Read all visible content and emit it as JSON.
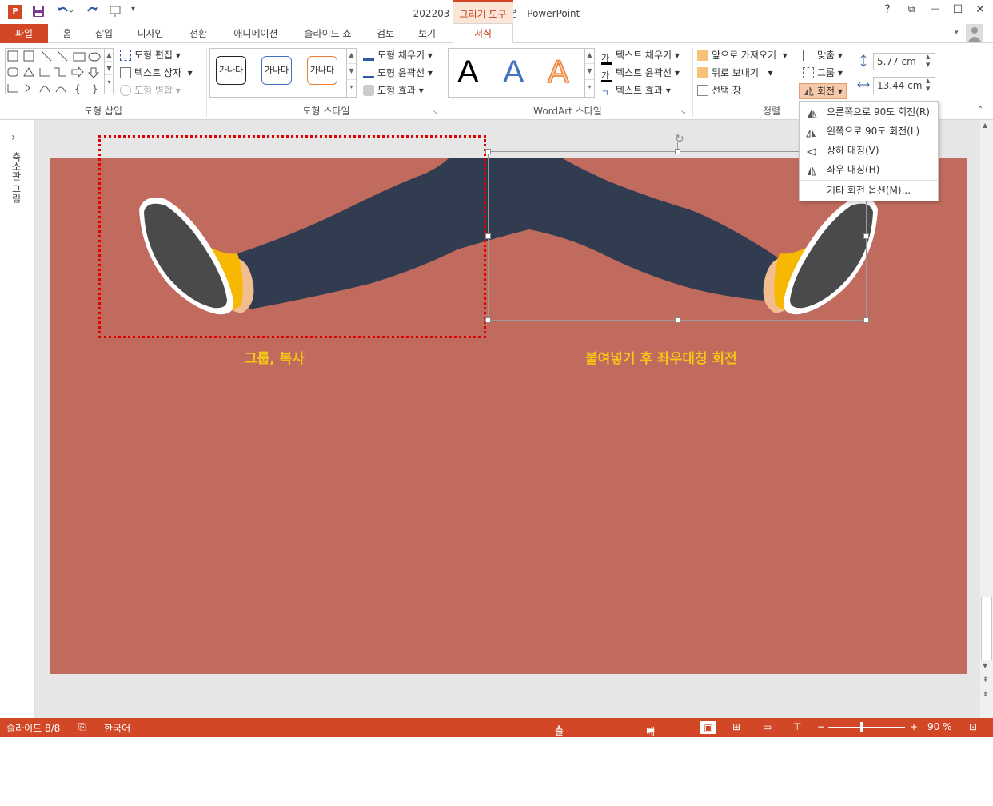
{
  "window": {
    "title": "202203 포스팅용 완성본 - PowerPoint",
    "context_tab": "그리기 도구",
    "help": "?",
    "restore": "⧉",
    "minimize": "—",
    "maximize": "☐",
    "close": "✕"
  },
  "tabs": {
    "file": "파일",
    "home": "홈",
    "insert": "삽입",
    "design": "디자인",
    "transitions": "전환",
    "animations": "애니메이션",
    "slideshow": "슬라이드 쇼",
    "review": "검토",
    "view": "보기",
    "format": "서식"
  },
  "ribbon": {
    "insert_shapes": {
      "label": "도형 삽입",
      "edit_shape": "도형 편집",
      "text_box": "텍스트 상자",
      "merge_shapes": "도형 병합"
    },
    "shape_styles": {
      "label": "도형 스타일",
      "style1": "가나다",
      "style2": "가나다",
      "style3": "가나다",
      "fill": "도형 채우기",
      "outline": "도형 윤곽선",
      "effects": "도형 효과"
    },
    "wordart": {
      "label": "WordArt 스타일",
      "letter": "A",
      "text_fill": "텍스트 채우기",
      "text_outline": "텍스트 윤곽선",
      "text_effects": "텍스트 효과",
      "text_fill_icon": "가"
    },
    "arrange": {
      "label": "정렬",
      "bring_forward": "앞으로 가져오기",
      "send_backward": "뒤로 보내기",
      "selection_pane": "선택 창",
      "align": "맞춤",
      "group": "그룹",
      "rotate": "회전"
    },
    "size": {
      "height": "5.77 cm",
      "width": "13.44 cm"
    }
  },
  "rotate_menu": {
    "items": [
      {
        "label": "오른쪽으로 90도 회전(R)"
      },
      {
        "label": "왼쪽으로 90도 회전(L)"
      },
      {
        "label": "상하 대칭(V)"
      },
      {
        "label": "좌우 대칭(H)"
      },
      {
        "label": "기타 회전 옵션(M)..."
      }
    ]
  },
  "left_pane": {
    "label": "축소판 그림",
    "expand": "›"
  },
  "slide": {
    "caption_left": "그룹, 복사",
    "caption_right": "붙여넣기 후 좌우대칭 회전",
    "caption_color": "#f5c518",
    "background_color": "#c16b5e"
  },
  "status": {
    "slide_count": "슬라이드 8/8",
    "language": "한국어",
    "notes": "슬라이드 노트",
    "comments": "메모",
    "zoom": "90 %"
  },
  "colors": {
    "accent": "#d24726",
    "pants": "#323c50",
    "sole": "#4a4a4a",
    "shoe": "#f6b800",
    "skin": "#f2bd8f"
  }
}
